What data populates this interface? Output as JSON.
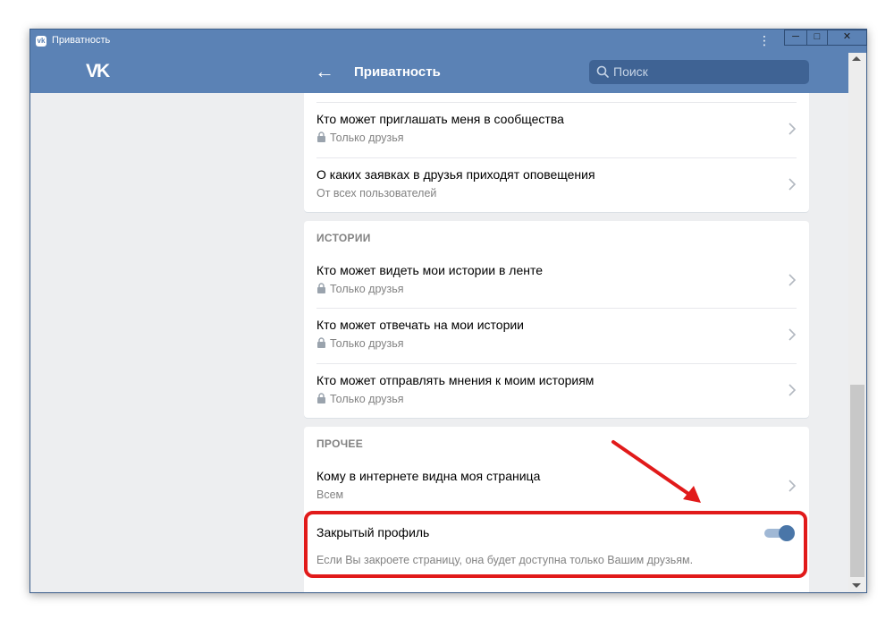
{
  "window": {
    "title": "Приватность",
    "controls": {
      "min": "─",
      "max": "□",
      "close": "✕"
    }
  },
  "header": {
    "logo": "VK",
    "title": "Приватность",
    "search_placeholder": "Поиск"
  },
  "sections": {
    "top": {
      "rows": [
        {
          "title": "Кто может приглашать меня в сообщества",
          "value": "Только друзья",
          "locked": true
        },
        {
          "title": "О каких заявках в друзья приходят оповещения",
          "value": "От всех пользователей",
          "locked": false
        }
      ]
    },
    "stories": {
      "heading": "ИСТОРИИ",
      "rows": [
        {
          "title": "Кто может видеть мои истории в ленте",
          "value": "Только друзья",
          "locked": true
        },
        {
          "title": "Кто может отвечать на мои истории",
          "value": "Только друзья",
          "locked": true
        },
        {
          "title": "Кто может отправлять мнения к моим историям",
          "value": "Только друзья",
          "locked": true
        }
      ]
    },
    "other": {
      "heading": "ПРОЧЕЕ",
      "rows": [
        {
          "title": "Кому в интернете видна моя страница",
          "value": "Всем"
        }
      ],
      "closed_profile": {
        "title": "Закрытый профиль",
        "description": "Если Вы закроете страницу, она будет доступна только Вашим друзьям.",
        "enabled": true
      }
    }
  },
  "colors": {
    "accent": "#4a76a8",
    "header": "#5b82b5",
    "annotation": "#e11a1a"
  }
}
